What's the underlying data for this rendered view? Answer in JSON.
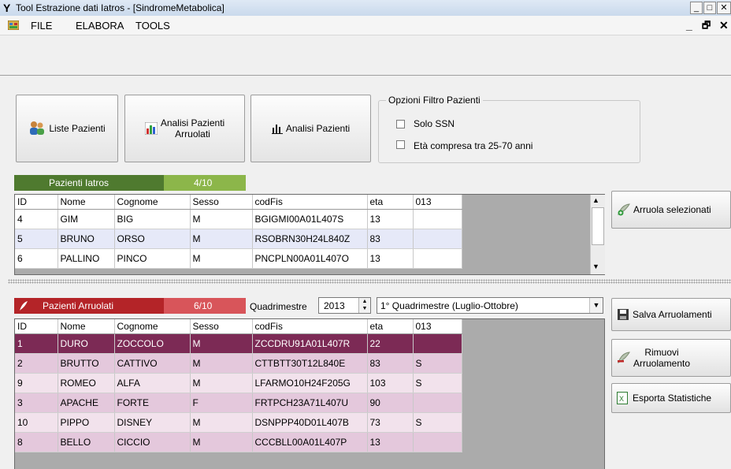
{
  "window": {
    "title": "Tool Estrazione dati Iatros - [SindromeMetabolica]",
    "controls": [
      "_",
      "□",
      "✕"
    ],
    "mdi_controls": [
      "_",
      "🗗",
      "✕"
    ]
  },
  "menu": {
    "items": [
      "FILE",
      "ELABORA",
      "TOOLS"
    ]
  },
  "toolbar": {
    "liste_pazienti": "Liste Pazienti",
    "analisi_arruolati_line1": "Analisi Pazienti",
    "analisi_arruolati_line2": "Arruolati",
    "analisi_pazienti": "Analisi Pazienti"
  },
  "filter": {
    "title": "Opzioni Filtro Pazienti",
    "solo_ssn": "Solo SSN",
    "eta": "Età compresa tra 25-70 anni",
    "solo_ssn_checked": false,
    "eta_checked": false
  },
  "patients": {
    "title": "Pazienti Iatros",
    "count": "4/10",
    "columns": [
      "ID",
      "Nome",
      "Cognome",
      "Sesso",
      "codFis",
      "eta",
      "013"
    ],
    "rows": [
      [
        "4",
        "GIM",
        "BIG",
        "M",
        "BGIGMI00A01L407S",
        "13",
        ""
      ],
      [
        "5",
        "BRUNO",
        "ORSO",
        "M",
        "RSOBRN30H24L840Z",
        "83",
        ""
      ],
      [
        "6",
        "PALLINO",
        "PINCO",
        "M",
        "PNCPLN00A01L407O",
        "13",
        ""
      ]
    ],
    "row_colors": [
      "#ffffff",
      "#e6e9f8",
      "#ffffff"
    ]
  },
  "enrolled": {
    "title": "Pazienti Arruolati",
    "count": "6/10",
    "quadrimestre_label": "Quadrimestre",
    "year": "2013",
    "period": "1° Quadrimestre (Luglio-Ottobre)",
    "columns": [
      "ID",
      "Nome",
      "Cognome",
      "Sesso",
      "codFis",
      "eta",
      "013"
    ],
    "rows": [
      [
        "1",
        "DURO",
        "ZOCCOLO",
        "M",
        "ZCCDRU91A01L407R",
        "22",
        ""
      ],
      [
        "2",
        "BRUTTO",
        "CATTIVO",
        "M",
        "CTTBTT30T12L840E",
        "83",
        "S"
      ],
      [
        "9",
        "ROMEO",
        "ALFA",
        "M",
        "LFARMO10H24F205G",
        "103",
        "S"
      ],
      [
        "3",
        "APACHE",
        "FORTE",
        "F",
        "FRTPCH23A71L407U",
        "90",
        ""
      ],
      [
        "10",
        "PIPPO",
        "DISNEY",
        "M",
        "DSNPPP40D01L407B",
        "73",
        "S"
      ],
      [
        "8",
        "BELLO",
        "CICCIO",
        "M",
        "CCCBLL00A01L407P",
        "13",
        ""
      ]
    ],
    "row_colors": [
      "#7c2a55",
      "#e4c8dc",
      "#f2e2ec",
      "#e4c8dc",
      "#f2e2ec",
      "#e4c8dc"
    ],
    "selected_row": 0
  },
  "side_buttons": {
    "arruola": "Arruola selezionati",
    "salva": "Salva Arruolamenti",
    "rimuovi_line1": "Rimuovi",
    "rimuovi_line2": "Arruolamento",
    "esporta": "Esporta Statistiche"
  },
  "colors": {
    "patients_header": "#4f7a2f",
    "patients_count": "#8cb64a",
    "enrolled_header": "#b42428",
    "enrolled_count": "#d8555a",
    "selected_row": "#7c2a55"
  }
}
